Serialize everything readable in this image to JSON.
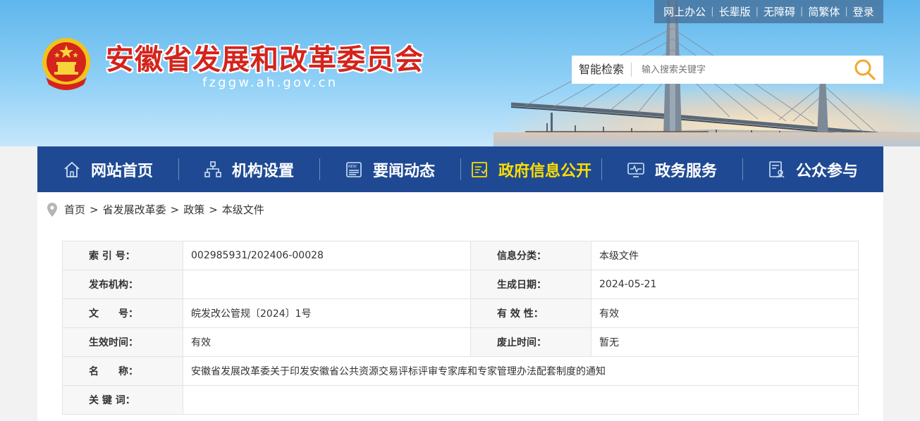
{
  "top_links": [
    "网上办公",
    "长辈版",
    "无障碍",
    "简繁体",
    "登录"
  ],
  "header": {
    "title": "安徽省发展和改革委员会",
    "domain": "fzggw.ah.gov.cn"
  },
  "search": {
    "label": "智能检索",
    "placeholder": "输入搜索关键字"
  },
  "nav": [
    {
      "label": "网站首页",
      "icon": "home-icon",
      "active": false
    },
    {
      "label": "机构设置",
      "icon": "org-chart-icon",
      "active": false
    },
    {
      "label": "要闻动态",
      "icon": "news-icon",
      "active": false
    },
    {
      "label": "政府信息公开",
      "icon": "info-open-icon",
      "active": true
    },
    {
      "label": "政务服务",
      "icon": "monitor-icon",
      "active": false
    },
    {
      "label": "公众参与",
      "icon": "participation-icon",
      "active": false
    }
  ],
  "colors": {
    "nav_bg": "#1f4a93",
    "nav_active": "#ffde00",
    "title_red": "#d4241c"
  },
  "breadcrumb": [
    "首页",
    "省发展改革委",
    "政策",
    "本级文件"
  ],
  "info_table": {
    "index_label": "索 引 号：",
    "index_value": "002985931/202406-00028",
    "category_label": "信息分类：",
    "category_value": "本级文件",
    "publisher_label": "发布机构：",
    "publisher_value": "",
    "date_label": "生成日期：",
    "date_value": "2024-05-21",
    "docno_label": "文　　号：",
    "docno_value": "皖发改公管规〔2024〕1号",
    "validity_label": "有 效 性：",
    "validity_value": "有效",
    "effective_label": "生效时间：",
    "effective_value": "有效",
    "abolish_label": "废止时间：",
    "abolish_value": "暂无",
    "name_label": "名　　称：",
    "name_value": "安徽省发展改革委关于印发安徽省公共资源交易评标评审专家库和专家管理办法配套制度的通知",
    "keywords_label": "关 键 词：",
    "keywords_value": ""
  }
}
